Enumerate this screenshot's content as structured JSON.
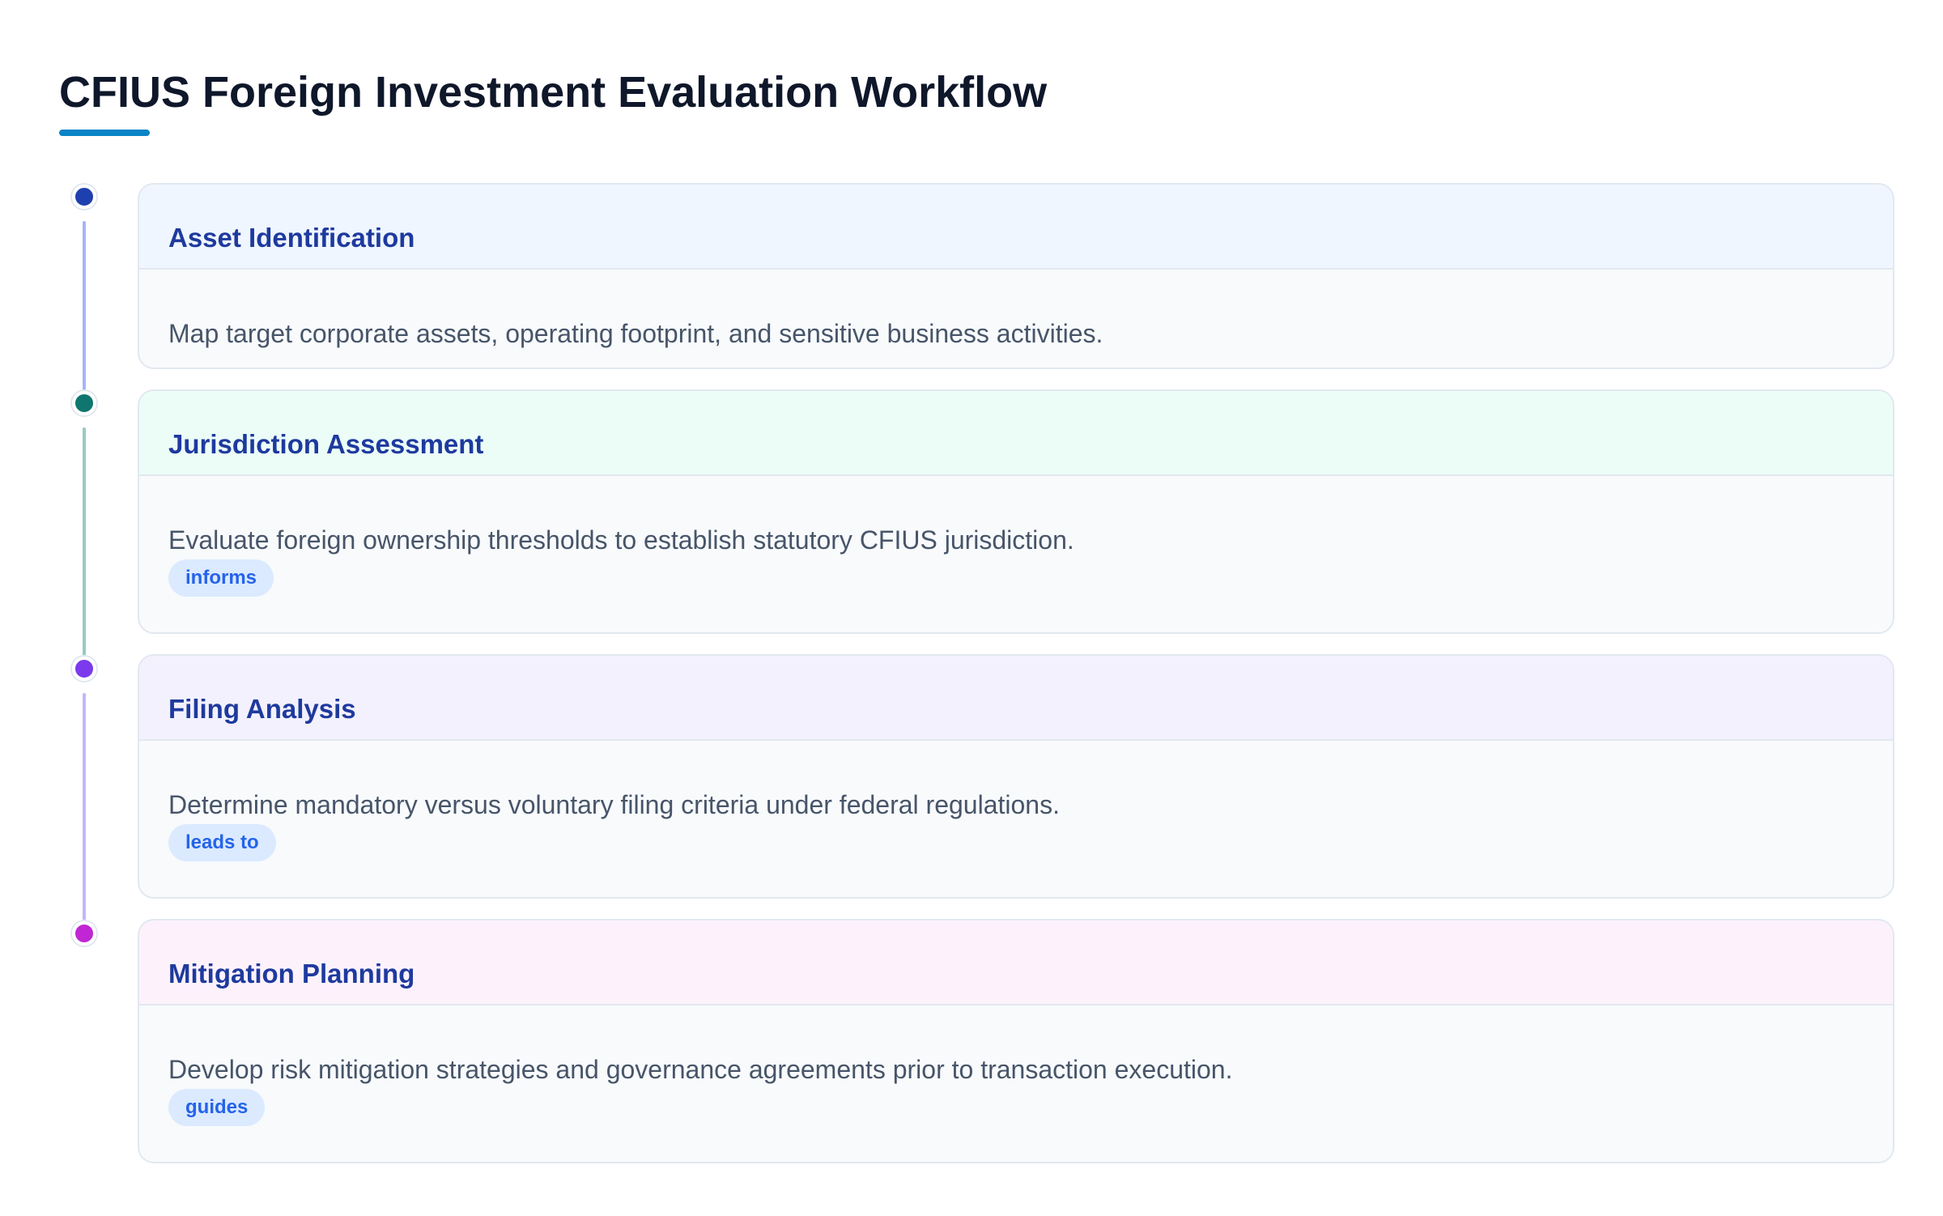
{
  "title": "CFIUS Foreign Investment Evaluation Workflow",
  "colors": {
    "accent": "#0a84c6",
    "step_title": "#1e3a9e",
    "badge_bg": "#dbeafe",
    "badge_text": "#2563eb"
  },
  "steps": [
    {
      "title": "Asset Identification",
      "description": "Map target corporate assets, operating footprint, and sensitive business activities.",
      "badge": "",
      "dot_color": "#1e40af",
      "header_bg": "#eff6ff",
      "line_color": "#a5b4fc"
    },
    {
      "title": "Jurisdiction Assessment",
      "description": "Evaluate foreign ownership thresholds to establish statutory CFIUS jurisdiction.",
      "badge": "informs",
      "dot_color": "#0f766e",
      "header_bg": "#ecfdf8",
      "line_color": "#99c9c2"
    },
    {
      "title": "Filing Analysis",
      "description": "Determine mandatory versus voluntary filing criteria under federal regulations.",
      "badge": "leads to",
      "dot_color": "#7c3aed",
      "header_bg": "#f3f1fd",
      "line_color": "#c4b5fd"
    },
    {
      "title": "Mitigation Planning",
      "description": "Develop risk mitigation strategies and governance agreements prior to transaction execution.",
      "badge": "guides",
      "dot_color": "#c026d3",
      "header_bg": "#fdf2fc",
      "line_color": ""
    }
  ]
}
